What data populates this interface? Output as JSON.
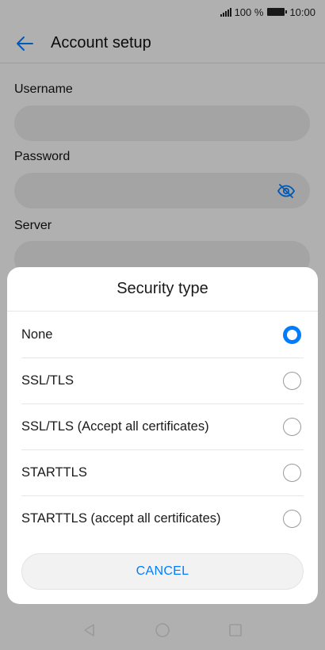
{
  "status_bar": {
    "battery_text": "100 %",
    "time": "10:00"
  },
  "app_bar": {
    "title": "Account setup",
    "back_icon": "arrow-left-icon"
  },
  "form": {
    "username_label": "Username",
    "password_label": "Password",
    "server_label": "Server",
    "password_visibility_icon": "eye-off-icon"
  },
  "dialog": {
    "title": "Security type",
    "options": [
      {
        "label": "None",
        "selected": true
      },
      {
        "label": "SSL/TLS",
        "selected": false
      },
      {
        "label": "SSL/TLS (Accept all certificates)",
        "selected": false
      },
      {
        "label": "STARTTLS",
        "selected": false
      },
      {
        "label": "STARTTLS (accept all certificates)",
        "selected": false
      }
    ],
    "cancel_label": "CANCEL"
  },
  "colors": {
    "accent": "#007dff",
    "field_background": "#e3e3e3",
    "scrim": "rgba(0,0,0,0.28)"
  },
  "nav_bar": {
    "icons": [
      "back-triangle-icon",
      "home-circle-icon",
      "recents-square-icon"
    ]
  }
}
